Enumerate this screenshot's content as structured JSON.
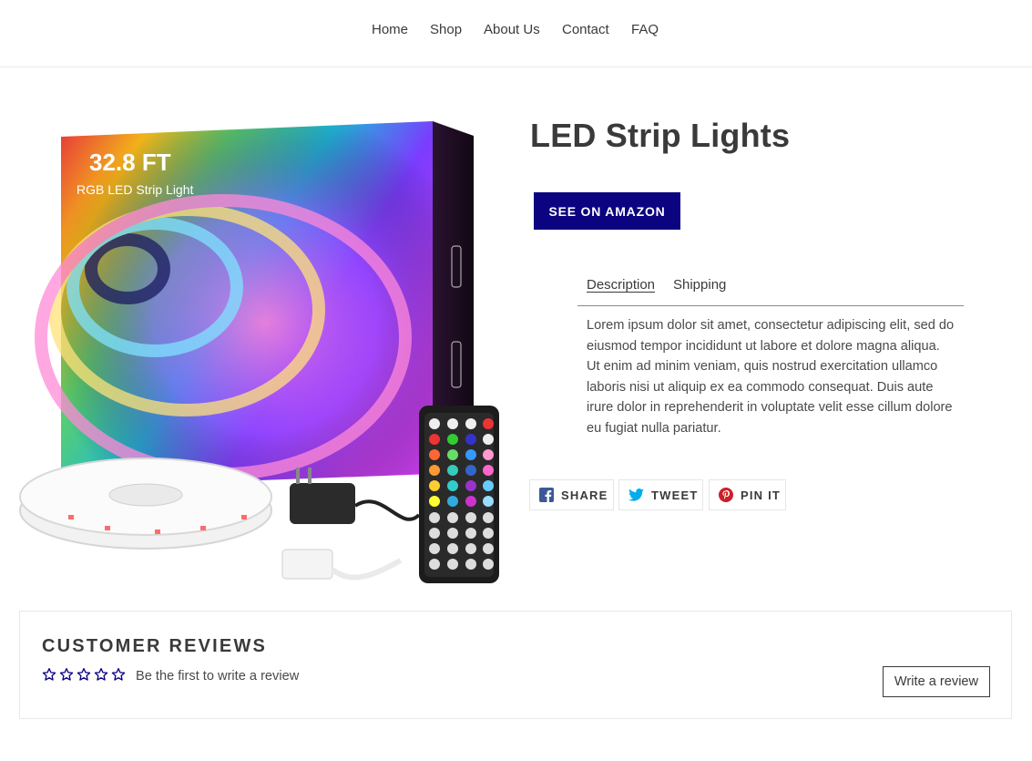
{
  "nav": {
    "items": [
      {
        "label": "Home"
      },
      {
        "label": "Shop"
      },
      {
        "label": "About Us"
      },
      {
        "label": "Contact"
      },
      {
        "label": "FAQ"
      }
    ]
  },
  "product": {
    "title": "LED Strip Lights",
    "image": {
      "box_headline": "32.8 FT",
      "box_subtitle": "RGB LED Strip Light"
    },
    "amazon_button": "SEE ON AMAZON",
    "tabs": [
      {
        "label": "Description",
        "active": true
      },
      {
        "label": "Shipping",
        "active": false
      }
    ],
    "description": "Lorem ipsum dolor sit amet, consectetur adipiscing elit, sed do eiusmod tempor incididunt ut labore et dolore magna aliqua. Ut enim ad minim veniam, quis nostrud exercitation ullamco laboris nisi ut aliquip ex ea commodo consequat. Duis aute irure dolor in reprehenderit in voluptate velit esse cillum dolore eu fugiat nulla pariatur."
  },
  "social": {
    "share": {
      "label": "SHARE",
      "icon": "facebook-icon",
      "color": "#3b5998"
    },
    "tweet": {
      "label": "TWEET",
      "icon": "twitter-icon",
      "color": "#00aced"
    },
    "pin": {
      "label": "PIN IT",
      "icon": "pinterest-icon",
      "color": "#cb2027"
    }
  },
  "reviews": {
    "title": "CUSTOMER REVIEWS",
    "rating_stars": 0,
    "star_color": "#0b0380",
    "summary": "Be the first to write a review",
    "write_button": "Write a review"
  },
  "colors": {
    "accent": "#0b0380",
    "text": "#3a3a3a"
  }
}
